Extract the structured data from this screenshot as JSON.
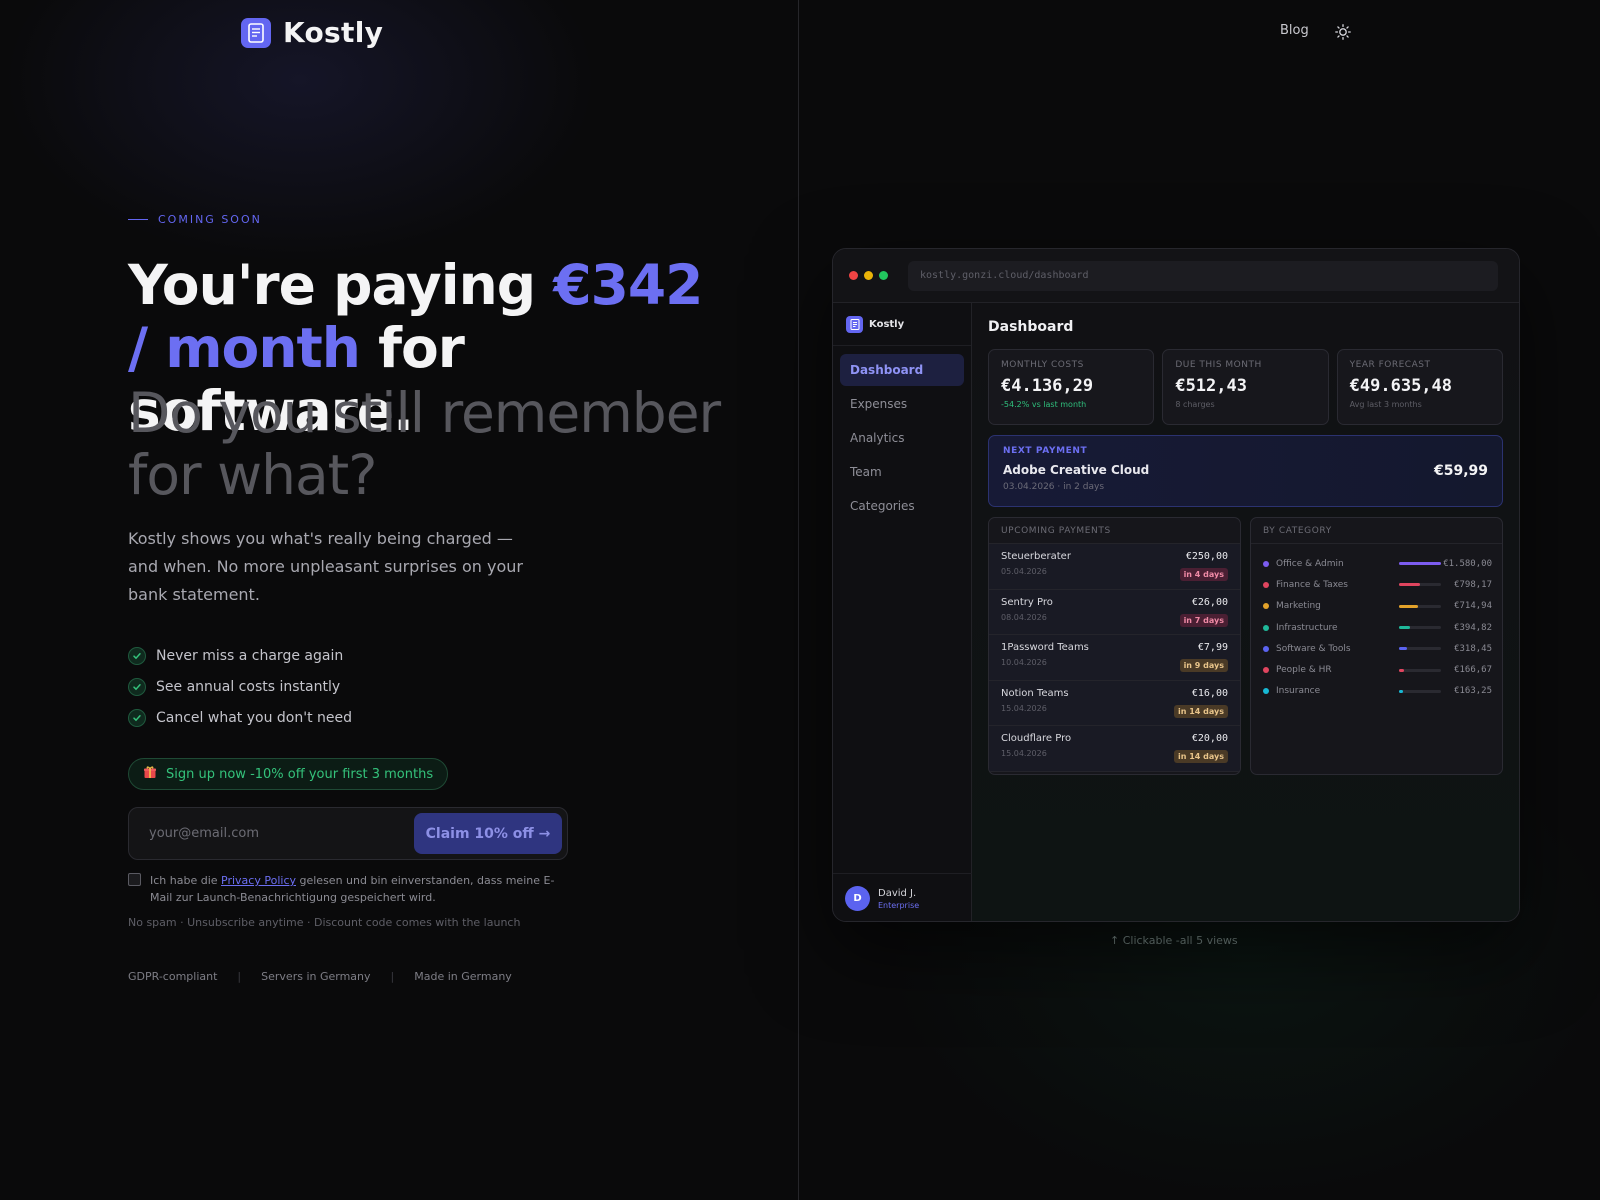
{
  "brand": {
    "name": "Kostly"
  },
  "nav": {
    "blog": "Blog"
  },
  "hero": {
    "eyebrow": "COMING SOON",
    "headline_pre": "You're paying ",
    "headline_accent": "€342 / month",
    "headline_post": " for software.",
    "headline_muted": "Do you still remember for what?",
    "lead": "Kostly shows you what's really being charged — and when. No more unpleasant surprises on your bank statement.",
    "checks": [
      "Never miss a charge again",
      "See annual costs instantly",
      "Cancel what you don't need"
    ],
    "promo": "Sign up now -10% off your first 3 months",
    "email_placeholder": "your@email.com",
    "cta": "Claim 10% off →",
    "consent_pre": "Ich habe die ",
    "consent_link": "Privacy Policy",
    "consent_post": " gelesen und bin einverstanden, dass meine E-Mail zur Launch-Benachrichtigung gespeichert wird.",
    "nospam": "No spam · Unsubscribe anytime · Discount code comes with the launch",
    "trust": [
      "GDPR-compliant",
      "Servers in Germany",
      "Made in Germany"
    ],
    "trust_sep": "|"
  },
  "app": {
    "url": "kostly.gonzi.cloud/dashboard",
    "brand": "Kostly",
    "nav": [
      "Dashboard",
      "Expenses",
      "Analytics",
      "Team",
      "Categories"
    ],
    "active_nav": "Dashboard",
    "user": {
      "initial": "D",
      "name": "David J.",
      "plan": "Enterprise"
    },
    "title": "Dashboard",
    "stats": [
      {
        "label": "MONTHLY COSTS",
        "value": "€4.136,29",
        "sub": "-54.2% vs last month"
      },
      {
        "label": "DUE THIS MONTH",
        "value": "€512,43",
        "sub": "8 charges"
      },
      {
        "label": "YEAR FORECAST",
        "value": "€49.635,48",
        "sub": "Avg last 3 months"
      }
    ],
    "next_payment": {
      "label": "NEXT PAYMENT",
      "name": "Adobe Creative Cloud",
      "date": "03.04.2026 · in 2 days",
      "amount": "€59,99"
    },
    "upcoming": {
      "title": "UPCOMING PAYMENTS",
      "rows": [
        {
          "name": "Steuerberater",
          "date": "05.04.2026",
          "amount": "€250,00",
          "badge": "in 4 days"
        },
        {
          "name": "Sentry Pro",
          "date": "08.04.2026",
          "amount": "€26,00",
          "badge": "in 7 days"
        },
        {
          "name": "1Password Teams",
          "date": "10.04.2026",
          "amount": "€7,99",
          "badge": "in 9 days"
        },
        {
          "name": "Notion Teams",
          "date": "15.04.2026",
          "amount": "€16,00",
          "badge": "in 14 days"
        },
        {
          "name": "Cloudflare Pro",
          "date": "15.04.2026",
          "amount": "€20,00",
          "badge": "in 14 days"
        }
      ]
    },
    "categories": {
      "title": "BY CATEGORY",
      "rows": [
        {
          "name": "Office & Admin",
          "amount": "€1.580,00",
          "share": 1.0,
          "color": "#7c5cf0"
        },
        {
          "name": "Finance & Taxes",
          "amount": "€798,17",
          "share": 0.5,
          "color": "#e0455f"
        },
        {
          "name": "Marketing",
          "amount": "€714,94",
          "share": 0.45,
          "color": "#e3a22a"
        },
        {
          "name": "Infrastructure",
          "amount": "€394,82",
          "share": 0.25,
          "color": "#1fb89a"
        },
        {
          "name": "Software & Tools",
          "amount": "€318,45",
          "share": 0.2,
          "color": "#5b63f0"
        },
        {
          "name": "People & HR",
          "amount": "€166,67",
          "share": 0.11,
          "color": "#e0455f"
        },
        {
          "name": "Insurance",
          "amount": "€163,25",
          "share": 0.1,
          "color": "#17b8d4"
        }
      ]
    }
  },
  "footer_note": "↑ Clickable -all 5 views",
  "colors": {
    "accent": "#6366f1",
    "success": "#2fbf7c"
  }
}
